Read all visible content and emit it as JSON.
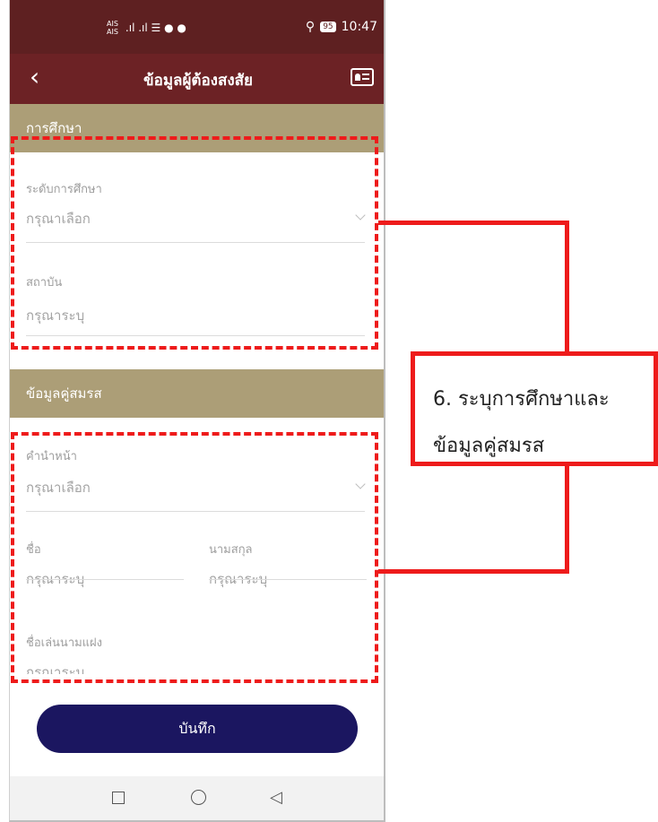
{
  "status_bar": {
    "carrier1": "AIS",
    "carrier2": "AIS",
    "signal": ".ıl .ıl ☰ ● ●",
    "battery": "95",
    "time": "10:47"
  },
  "app_bar": {
    "back": "‹",
    "title": "ข้อมูลผู้ต้องสงสัย"
  },
  "education": {
    "header": "การศึกษา",
    "level_label": "ระดับการศึกษา",
    "level_value": "กรุณาเลือก",
    "institute_label": "สถาบัน",
    "institute_value": "กรุณาระบุ"
  },
  "spouse": {
    "header": "ข้อมูลคู่สมรส",
    "prefix_label": "คำนำหน้า",
    "prefix_value": "กรุณาเลือก",
    "first_name_label": "ชื่อ",
    "first_name_value": "กรุณาระบุ",
    "last_name_label": "นามสกุล",
    "last_name_value": "กรุณาระบุ",
    "nickname_label": "ชื่อเล่นนามแฝง",
    "nickname_value": "กรุณาระบุ"
  },
  "save_button": "บันทึก",
  "annotation": {
    "line1": "6. ระบุการศึกษาและ",
    "line2": "ข้อมูลคู่สมรส",
    "color": "#ee1b1b"
  },
  "colors": {
    "status_bar": "#5e2021",
    "app_bar": "#6c2225",
    "section_header": "#ac9e77",
    "save_button": "#1b1660"
  }
}
